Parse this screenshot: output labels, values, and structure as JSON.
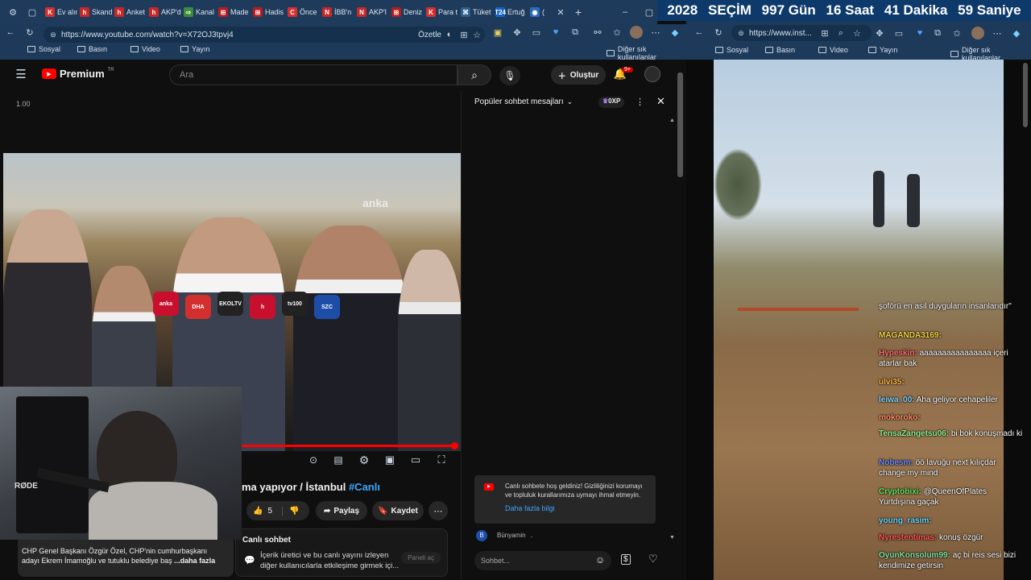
{
  "tabs": [
    {
      "label": "Ev alın",
      "color": "#d32f2f",
      "glyph": "K"
    },
    {
      "label": "Skand",
      "color": "#c62828",
      "glyph": "h"
    },
    {
      "label": "Anket",
      "color": "#c62828",
      "glyph": "h"
    },
    {
      "label": "AKP'd",
      "color": "#c62828",
      "glyph": "h"
    },
    {
      "label": "Kanal",
      "color": "#3c8c3c",
      "glyph": "⇨"
    },
    {
      "label": "Made",
      "color": "#b71c1c",
      "glyph": "⊞"
    },
    {
      "label": "Hadis",
      "color": "#b71c1c",
      "glyph": "⊞"
    },
    {
      "label": "Önce",
      "color": "#d32f2f",
      "glyph": "C"
    },
    {
      "label": "İBB'n",
      "color": "#c62828",
      "glyph": "N"
    },
    {
      "label": "AKP'l",
      "color": "#c62828",
      "glyph": "N"
    },
    {
      "label": "Deniz",
      "color": "#b71c1c",
      "glyph": "⊞"
    },
    {
      "label": "Para t",
      "color": "#d32f2f",
      "glyph": "K"
    },
    {
      "label": "Tüket",
      "color": "#2e5f8f",
      "glyph": "⌘"
    },
    {
      "label": "Ertuğ",
      "color": "#1565c0",
      "glyph": "T24"
    },
    {
      "label": "(",
      "color": "#2d6cb5",
      "glyph": "◉"
    }
  ],
  "countdown": {
    "year": "2028",
    "label": "SEÇİM",
    "days": "997 Gün",
    "hours": "16 Saat",
    "minutes": "41 Dakika",
    "seconds": "59 Saniye"
  },
  "left_browser": {
    "url": "https://www.youtube.com/watch?v=X72OJ3tpvj4",
    "summarize": "Özetle",
    "bookmarks": [
      "Sosyal",
      "Basın",
      "Video",
      "Yayın"
    ],
    "other_bookmarks": "Diğer sık kullanılanlar"
  },
  "right_browser": {
    "url": "https://www.inst...",
    "bookmarks": [
      "Sosyal",
      "Basın",
      "Video",
      "Yayın"
    ],
    "other_bookmarks": "Diğer sık kullanılanlar"
  },
  "youtube": {
    "logo": "Premium",
    "logo_sup": "TR",
    "search_placeholder": "Ara",
    "create": "Oluştur",
    "notif_count": "9+",
    "speed": "1.00",
    "title_partial": "ma yapıyor / İstanbul",
    "title_tag": "#Canlı",
    "likes": "5",
    "share": "Paylaş",
    "save": "Kaydet",
    "desc_line1": "CHP Genel Başkanı Özgür Özel, CHP'nin cumhurbaşkanı",
    "desc_line2": "adayı Ekrem İmamoğlu ve tutuklu belediye baş",
    "desc_more": "...daha fazla",
    "live_chat_title": "Canlı sohbet",
    "live_chat_desc1": "İçerik üretici ve bu canlı yayını izleyen",
    "live_chat_desc2": "diğer kullanıcılarla etkileşime girmek içi...",
    "open_panel": "Paneli aç",
    "video_watermark": "anka",
    "mic_labels": [
      "anka",
      "DHA",
      "EKOLTV",
      "h",
      "tv100",
      "SZC"
    ]
  },
  "chat": {
    "header": "Popüler sohbet mesajları",
    "xp": "0XP",
    "welcome1": "Canlı sohbete hoş geldiniz! Gizliliğinizi korumayı",
    "welcome2": "ve topluluk kurallarımıza uymayı ihmal etmeyin.",
    "learn_more": "Daha fazla bilgi",
    "user_initial": "B",
    "user_name": "Bünyamin",
    "user_msg": ".",
    "input_placeholder": "Sohbet..."
  },
  "webcam": {
    "mic_brand": "RØDE"
  },
  "insta_comments": [
    {
      "user": "",
      "msg": "şoförü en asil duyguların insanlarıdır\"",
      "ucolor": "#fff"
    },
    {
      "user": "MAGANDA3169:",
      "msg": "",
      "ucolor": "#f0d040"
    },
    {
      "user": "Hypeskin:",
      "msg": "aaaaaaaaaaaaaaaa içeri atarlar bak",
      "ucolor": "#ff6b6b"
    },
    {
      "user": "ulvi35:",
      "msg": "",
      "ucolor": "#ffb347"
    },
    {
      "user": "leiwa_00:",
      "msg": "Aha geliyor cehapeliler",
      "ucolor": "#7fd4ff"
    },
    {
      "user": "mokoroko:",
      "msg": "",
      "ucolor": "#ff8a65"
    },
    {
      "user": "TensaZangetsu06:",
      "msg": "bi bok konuşmadı ki",
      "ucolor": "#8ef08e"
    },
    {
      "user": "Nobesm:",
      "msg": "öö lavuğu next kılıçdar change my mind",
      "ucolor": "#6a8cff"
    },
    {
      "user": "Cryptobixi:",
      "msg": "@QueenOfPlates Yurtdışına gaçak",
      "ucolor": "#5fe35f"
    },
    {
      "user": "young_rasim:",
      "msg": "",
      "ucolor": "#6bd6ff"
    },
    {
      "user": "Nyrestentimas:",
      "msg": "konuş özgür",
      "ucolor": "#ff5555"
    },
    {
      "user": "OyunKonsolum99:",
      "msg": "aç bi reis sesi bizi kendimize getirsin",
      "ucolor": "#7fe0a0"
    }
  ]
}
